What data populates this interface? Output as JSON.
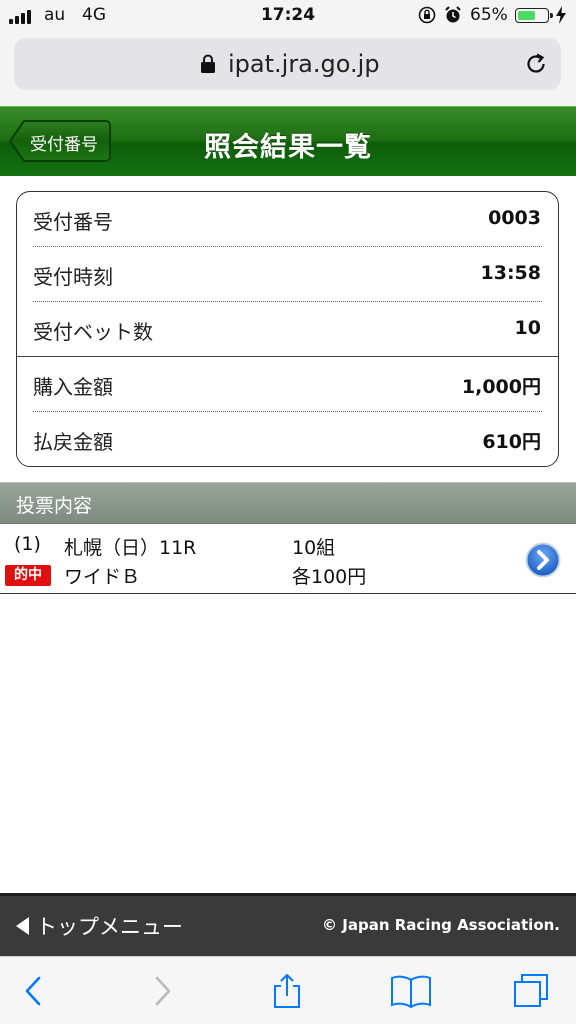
{
  "status_bar": {
    "carrier": "au",
    "network": "4G",
    "time": "17:24",
    "battery_percent": "65%",
    "battery_level": 0.65,
    "icons": [
      "signal-icon",
      "rotation-lock-icon",
      "alarm-icon",
      "battery-icon",
      "charging-icon"
    ]
  },
  "browser": {
    "url": "ipat.jra.go.jp",
    "icons": [
      "lock-icon",
      "reload-icon"
    ]
  },
  "header": {
    "back_label": "受付番号",
    "title": "照会結果一覧",
    "colors": {
      "header_green": "#1c6e12"
    }
  },
  "summary": {
    "rows": [
      {
        "label": "受付番号",
        "value": "0003"
      },
      {
        "label": "受付時刻",
        "value": "13:58"
      },
      {
        "label": "受付ベット数",
        "value": "10"
      },
      {
        "label": "購入金額",
        "value": "1,000円"
      },
      {
        "label": "払戻金額",
        "value": "610円"
      }
    ]
  },
  "section": {
    "title": "投票内容"
  },
  "vote": {
    "index": "(1)",
    "race": "札幌（日）11R",
    "combos": "10組",
    "badge": "的中",
    "bet_type": "ワイドＢ",
    "stake": "各100円",
    "colors": {
      "badge_red": "#e01010",
      "arrow_blue": "#2a6fd6"
    }
  },
  "footer": {
    "menu_label": "トップメニュー",
    "copyright": "© Japan Racing Association."
  },
  "toolbar": {
    "icons": [
      "back-icon",
      "forward-icon",
      "share-icon",
      "bookmarks-icon",
      "tabs-icon"
    ],
    "accent": "#007aff"
  }
}
